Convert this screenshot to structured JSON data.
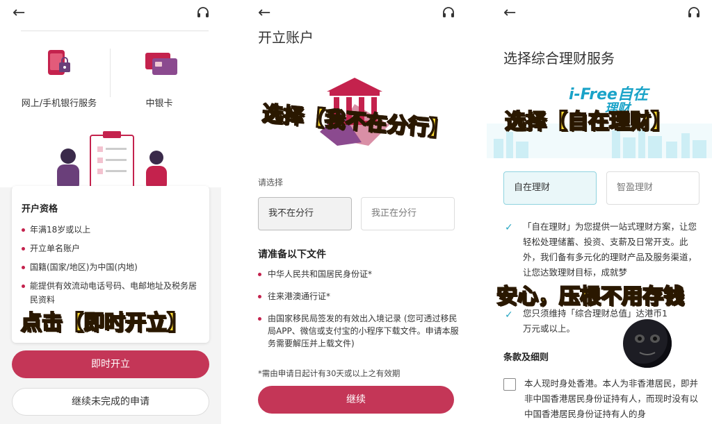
{
  "panel1": {
    "services": [
      {
        "label": "网上/手机银行服务"
      },
      {
        "label": "中银卡"
      }
    ],
    "eligibility_title": "开户资格",
    "eligibility": [
      "年满18岁或以上",
      "开立单名账户",
      "国籍(国家/地区)为中国(内地)",
      "能提供有效流动电话号码、电邮地址及税务居民资料"
    ],
    "primary_button": "即时开立",
    "secondary_button": "继续未完成的申请",
    "overlay": "点击【即时开立】"
  },
  "panel2": {
    "title": "开立账户",
    "overlay": "选择【我不在分行】",
    "choose_label": "请选择",
    "options": [
      "我不在分行",
      "我正在分行"
    ],
    "docs_title": "请准备以下文件",
    "docs": [
      "中华人民共和国居民身份证*",
      "往来港澳通行证*",
      "由国家移民局签发的有效出入境记录 (您可透过移民局APP、微信或支付宝的小程序下载文件。申请本服务需要解压并上载文件)"
    ],
    "note": "*需由申请日起计有30天或以上之有效期",
    "continue_button": "继续"
  },
  "panel3": {
    "title": "选择综合理财服务",
    "logo_line1": "i-Free自在",
    "logo_line2": "理财",
    "overlay1": "选择【自在理财】",
    "options": [
      "自在理财",
      "智盈理财"
    ],
    "desc1": "「自在理财」为您提供一站式理财方案，让您轻松处理储蓄、投资、支薪及日常开支。此外，我们备有多元化的理财产品及服务渠道，让您达致理财目标，成就梦",
    "overlay2": "安心，压根不用存钱",
    "desc2": "您只须维持「综合理财总值」达港币1万元或以上。",
    "terms_title": "条款及细则",
    "terms_text": "本人现时身处香港。本人为非香港居民，即并非中国香港居民身份证持有人，而现时没有以中国香港居民身份证持有人的身"
  },
  "colors": {
    "brand": "#c43657",
    "accent": "#27a6c2",
    "overlay_yellow": "#ffdd33"
  },
  "icons": {
    "back": "back-arrow-icon",
    "support": "headset-icon"
  }
}
